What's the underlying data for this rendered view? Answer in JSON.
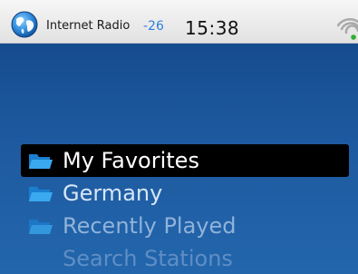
{
  "statusbar": {
    "app_title": "Internet Radio",
    "signal_level": "-26",
    "time": "15:38",
    "icons": [
      "globe-icon",
      "wifi-icon"
    ]
  },
  "menu": {
    "items": [
      {
        "label": "My Favorites",
        "selected": true,
        "icon": "folder-icon"
      },
      {
        "label": "Germany",
        "selected": false,
        "icon": "folder-icon"
      },
      {
        "label": "Recently Played",
        "selected": false,
        "icon": "folder-icon"
      },
      {
        "label": "Search Stations",
        "selected": false,
        "icon": "none"
      }
    ]
  },
  "colors": {
    "background_top": "#164c8f",
    "background_bottom": "#2366ac",
    "selection": "#000000",
    "signal_text": "#2f7fe0",
    "folder": "#2b9be6",
    "wifi_active": "#2fae2f"
  }
}
